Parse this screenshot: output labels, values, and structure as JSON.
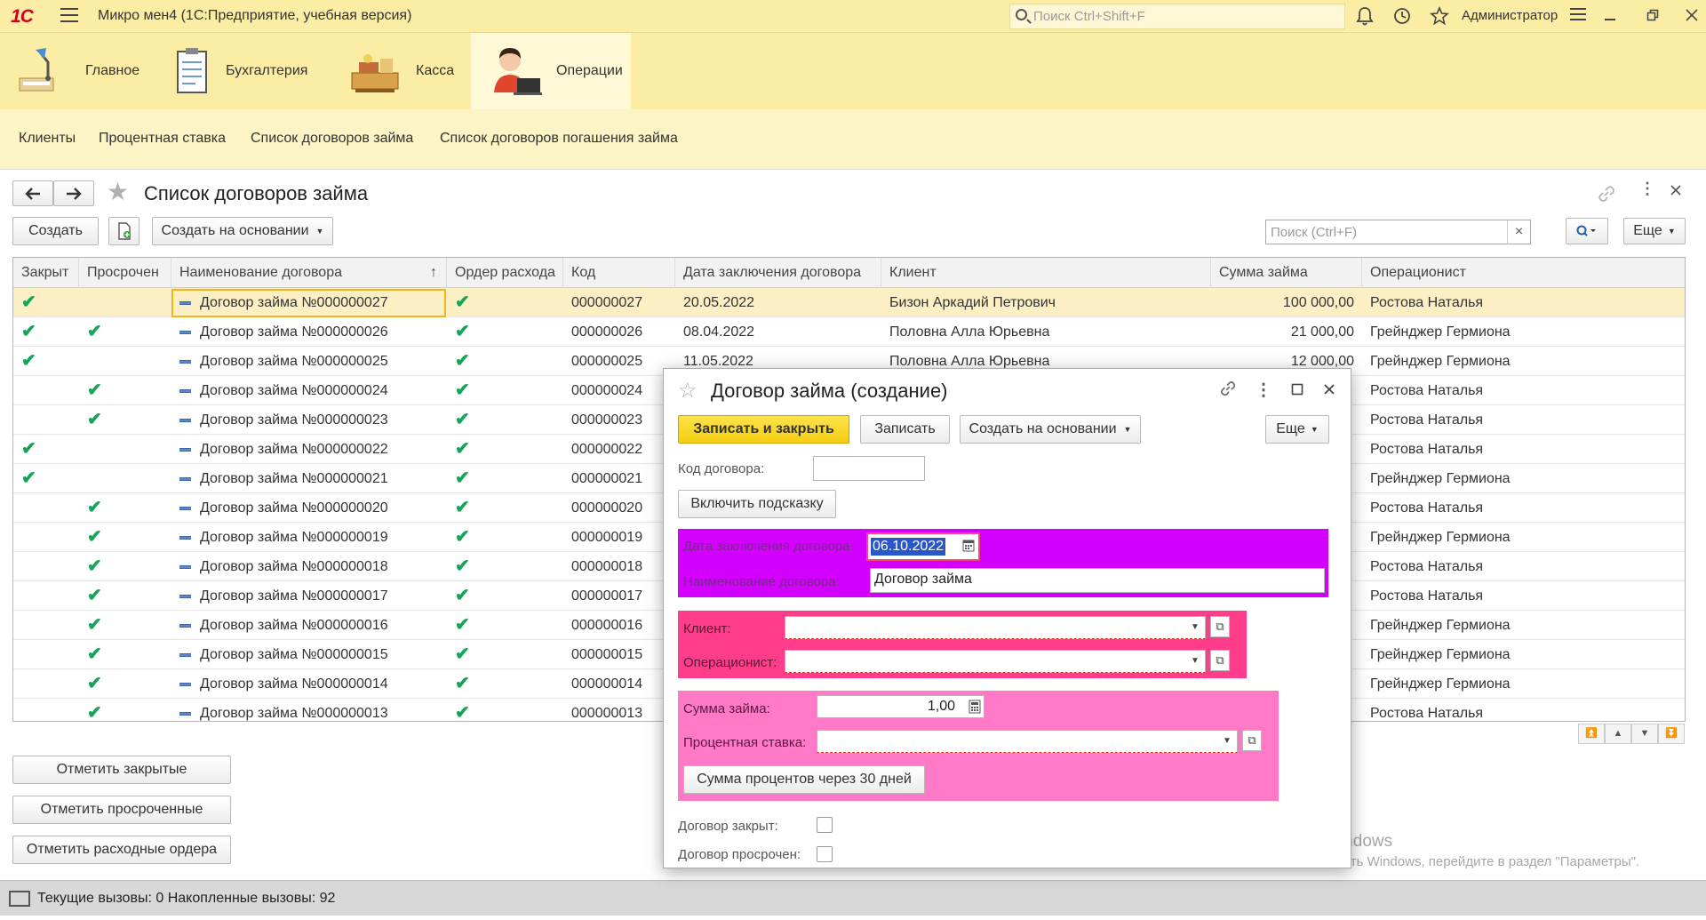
{
  "titlebar": {
    "logo": "1С",
    "title": "Микро мен4  (1С:Предприятие, учебная версия)",
    "search_placeholder": "Поиск Ctrl+Shift+F",
    "user": "Администратор"
  },
  "sections": [
    {
      "label": "Главное",
      "icon": "desk-lamp-icon"
    },
    {
      "label": "Бухгалтерия",
      "icon": "clipboard-icon"
    },
    {
      "label": "Касса",
      "icon": "cash-register-icon"
    },
    {
      "label": "Операции",
      "icon": "operator-icon",
      "active": true
    }
  ],
  "nav": {
    "items": [
      "Клиенты",
      "Процентная ставка",
      "Список договоров займа",
      "Список договоров погашения займа"
    ]
  },
  "list_form": {
    "title": "Список договоров займа",
    "create_label": "Создать",
    "create_based_label": "Создать на основании",
    "search_placeholder": "Поиск (Ctrl+F)",
    "search_clear": "×",
    "more_label": "Еще",
    "columns": [
      "Закрыт",
      "Просрочен",
      "Наименование договора",
      "Ордер расхода",
      "Код",
      "Дата заключения договора",
      "Клиент",
      "Сумма займа",
      "Операционист"
    ],
    "sort_indicator": "↑",
    "rows": [
      {
        "closed": "✔",
        "overdue": "",
        "name": "Договор займа №000000027",
        "order": "✔",
        "code": "000000027",
        "date": "20.05.2022",
        "client": "Бизон Аркадий Петрович",
        "sum": "100 000,00",
        "operator": "Ростова Наталья"
      },
      {
        "closed": "✔",
        "overdue": "✔",
        "name": "Договор займа №000000026",
        "order": "✔",
        "code": "000000026",
        "date": "08.04.2022",
        "client": "Половна Алла Юрьевна",
        "sum": "21 000,00",
        "operator": "Грейнджер Гермиона"
      },
      {
        "closed": "✔",
        "overdue": "",
        "name": "Договор займа №000000025",
        "order": "✔",
        "code": "000000025",
        "date": "11.05.2022",
        "client": "Половна Алла Юрьевна",
        "sum": "12 000,00",
        "operator": "Грейнджер Гермиона"
      },
      {
        "closed": "",
        "overdue": "✔",
        "name": "Договор займа №000000024",
        "order": "✔",
        "code": "000000024",
        "date": "",
        "client": "",
        "sum": "",
        "operator": "Ростова Наталья"
      },
      {
        "closed": "",
        "overdue": "✔",
        "name": "Договор займа №000000023",
        "order": "✔",
        "code": "000000023",
        "date": "",
        "client": "",
        "sum": "",
        "operator": "Ростова Наталья"
      },
      {
        "closed": "✔",
        "overdue": "",
        "name": "Договор займа №000000022",
        "order": "✔",
        "code": "000000022",
        "date": "",
        "client": "",
        "sum": "",
        "operator": "Ростова Наталья"
      },
      {
        "closed": "✔",
        "overdue": "",
        "name": "Договор займа №000000021",
        "order": "✔",
        "code": "000000021",
        "date": "",
        "client": "",
        "sum": "",
        "operator": "Грейнджер Гермиона"
      },
      {
        "closed": "",
        "overdue": "✔",
        "name": "Договор займа №000000020",
        "order": "✔",
        "code": "000000020",
        "date": "",
        "client": "",
        "sum": "",
        "operator": "Ростова Наталья"
      },
      {
        "closed": "",
        "overdue": "✔",
        "name": "Договор займа №000000019",
        "order": "✔",
        "code": "000000019",
        "date": "",
        "client": "",
        "sum": "",
        "operator": "Грейнджер Гермиона"
      },
      {
        "closed": "",
        "overdue": "✔",
        "name": "Договор займа №000000018",
        "order": "✔",
        "code": "000000018",
        "date": "",
        "client": "",
        "sum": "",
        "operator": "Ростова Наталья"
      },
      {
        "closed": "",
        "overdue": "✔",
        "name": "Договор займа №000000017",
        "order": "✔",
        "code": "000000017",
        "date": "",
        "client": "",
        "sum": "",
        "operator": "Ростова Наталья"
      },
      {
        "closed": "",
        "overdue": "✔",
        "name": "Договор займа №000000016",
        "order": "✔",
        "code": "000000016",
        "date": "",
        "client": "",
        "sum": "",
        "operator": "Грейнджер Гермиона"
      },
      {
        "closed": "",
        "overdue": "✔",
        "name": "Договор займа №000000015",
        "order": "✔",
        "code": "000000015",
        "date": "",
        "client": "",
        "sum": "",
        "operator": "Грейнджер Гермиона"
      },
      {
        "closed": "",
        "overdue": "✔",
        "name": "Договор займа №000000014",
        "order": "✔",
        "code": "000000014",
        "date": "",
        "client": "",
        "sum": "",
        "operator": "Грейнджер Гермиона"
      },
      {
        "closed": "",
        "overdue": "✔",
        "name": "Договор займа №000000013",
        "order": "✔",
        "code": "000000013",
        "date": "",
        "client": "",
        "sum": "",
        "operator": "Ростова Наталья"
      }
    ],
    "mark_closed_label": "Отметить закрытые",
    "mark_overdue_label": "Отметить просроченные",
    "mark_orders_label": "Отметить расходные ордера"
  },
  "dialog": {
    "title": "Договор займа (создание)",
    "save_close_label": "Записать и закрыть",
    "save_label": "Записать",
    "create_based_label": "Создать на основании",
    "more_label": "Еще",
    "code_label": "Код договора:",
    "code_value": "",
    "hint_label": "Включить подсказку",
    "date_label": "Дата заключения договора:",
    "date_value": "06.10.2022",
    "name_label": "Наименование договора:",
    "name_value": "Договор займа",
    "client_label": "Клиент:",
    "client_value": "",
    "operator_label": "Операционист:",
    "operator_value": "",
    "sum_label": "Сумма займа:",
    "sum_value": "1,00",
    "rate_label": "Процентная ставка:",
    "rate_value": "",
    "interest_button": "Сумма процентов через 30 дней",
    "closed_label": "Договор закрыт:",
    "overdue_label": "Договор просрочен:",
    "colors": {
      "group1": "#d400ff",
      "group2": "#ff3d8a",
      "group3": "#ff79c6"
    }
  },
  "statusbar": {
    "text": "Текущие вызовы: 0   Накопленные вызовы: 92"
  },
  "watermark": {
    "line1": "Активация Windows",
    "line2": "Чтобы активировать Windows, перейдите в раздел \"Параметры\"."
  }
}
